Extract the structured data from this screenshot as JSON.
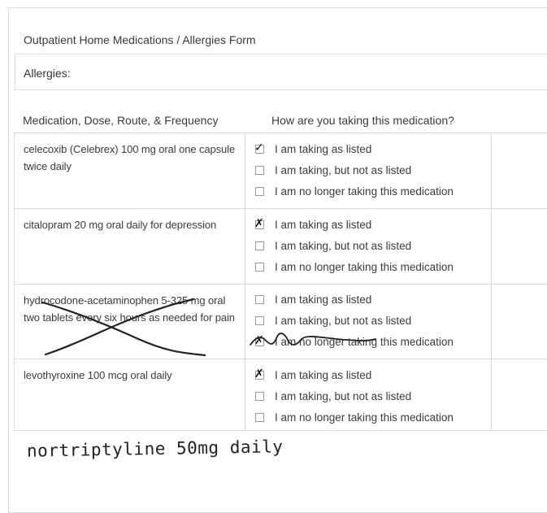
{
  "form": {
    "title": "Outpatient Home Medications / Allergies Form",
    "allergies_label": "Allergies:"
  },
  "columns": {
    "medication": "Medication, Dose, Route, & Frequency",
    "status": "How are you taking this medication?"
  },
  "options": [
    "I am taking as listed",
    "I am taking, but not as listed",
    "I am no longer taking this medication"
  ],
  "medications": [
    {
      "text": "celecoxib (Celebrex) 100 mg oral one capsule twice daily",
      "checked": 0,
      "mark": "✓"
    },
    {
      "text": "citalopram 20 mg oral daily for depression",
      "checked": 0,
      "mark": "✗"
    },
    {
      "text": "hydrocodone-acetaminophen 5-325 mg oral two tablets every six hours as needed for pain",
      "checked": 2,
      "mark": "✗",
      "crossed_out": true
    },
    {
      "text": "levothyroxine 100 mcg oral daily",
      "checked": 0,
      "mark": "✗"
    }
  ],
  "handwritten_note": "nortriptyline 50mg daily"
}
